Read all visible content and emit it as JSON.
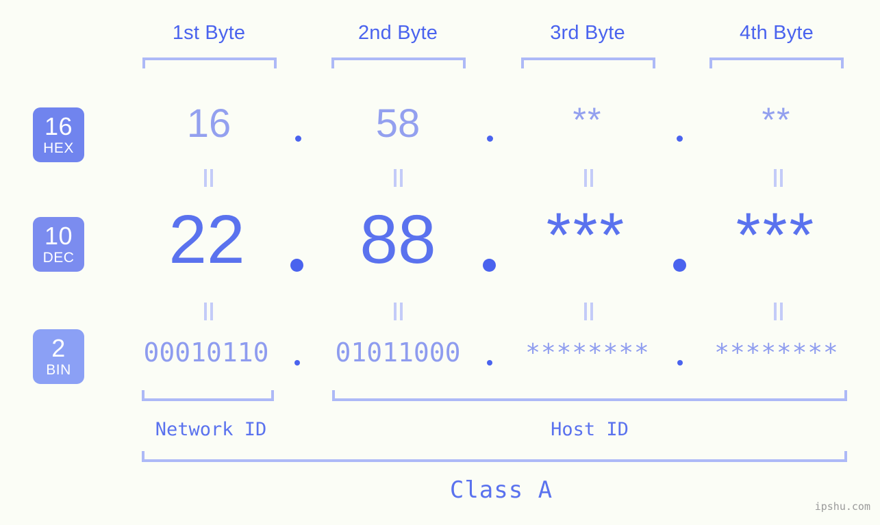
{
  "page": {
    "background_color": "#fbfdf6",
    "accent_color": "#4a63ee",
    "accent_light_color": "#adb9f7",
    "watermark": "ipshu.com"
  },
  "byte_headers": [
    {
      "label": "1st Byte"
    },
    {
      "label": "2nd Byte"
    },
    {
      "label": "3rd Byte"
    },
    {
      "label": "4th Byte"
    }
  ],
  "bases": [
    {
      "number": "16",
      "name": "HEX",
      "color": "#7084ee"
    },
    {
      "number": "10",
      "name": "DEC",
      "color": "#7b8cef"
    },
    {
      "number": "2",
      "name": "BIN",
      "color": "#8ba0f5"
    }
  ],
  "rows": {
    "hex": {
      "base_label": "16",
      "base_name": "HEX",
      "values": [
        "16",
        "58",
        "**",
        "**"
      ],
      "separator": "."
    },
    "dec": {
      "base_label": "10",
      "base_name": "DEC",
      "values": [
        "22",
        "88",
        "***",
        "***"
      ],
      "separator": "."
    },
    "bin": {
      "base_label": "2",
      "base_name": "BIN",
      "values": [
        "00010110",
        "01011000",
        "********",
        "********"
      ],
      "separator": "."
    }
  },
  "equals_symbol": "=",
  "footer": {
    "network_id_label": "Network ID",
    "host_id_label": "Host ID",
    "class_label": "Class A"
  }
}
